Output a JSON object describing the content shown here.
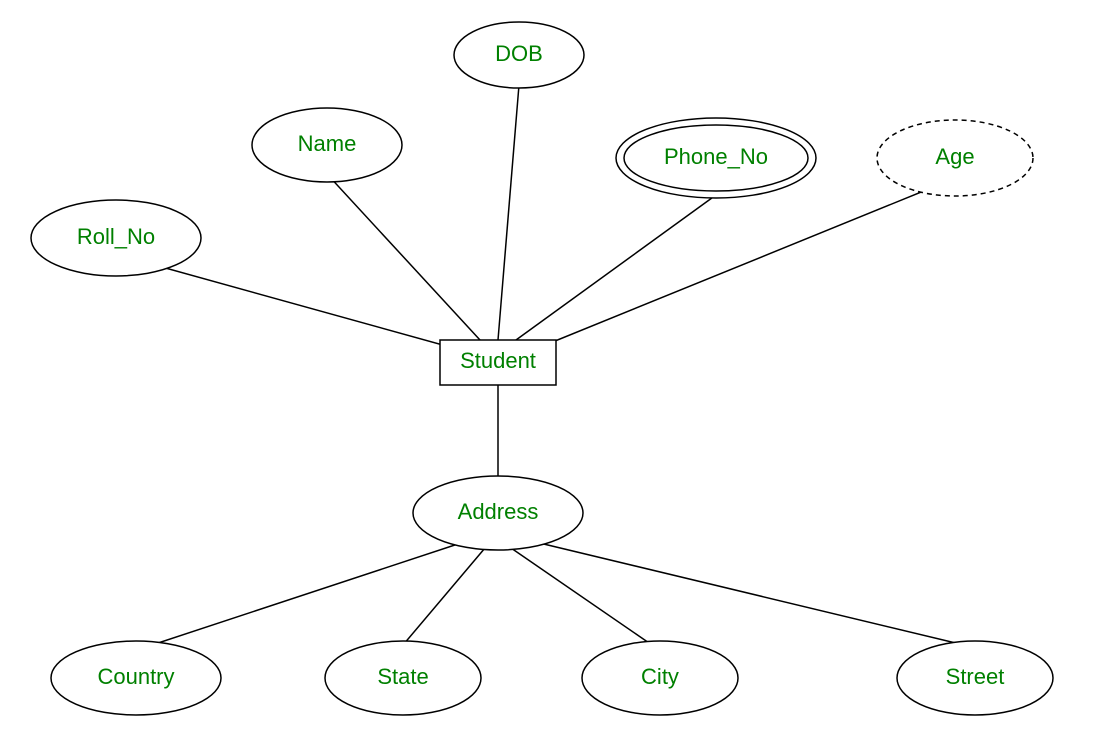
{
  "entity": {
    "name": "Student"
  },
  "attributes": {
    "roll_no": "Roll_No",
    "name": "Name",
    "dob": "DOB",
    "phone_no": "Phone_No",
    "age": "Age",
    "address": "Address"
  },
  "address_sub_attributes": {
    "country": "Country",
    "state": "State",
    "city": "City",
    "street": "Street"
  }
}
